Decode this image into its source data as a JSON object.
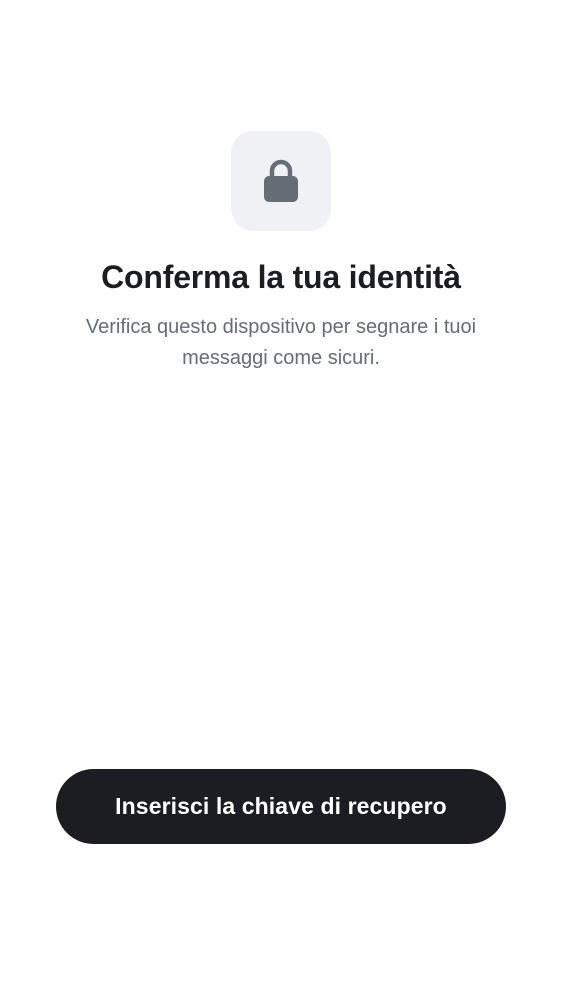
{
  "screen": {
    "icon": "lock-icon",
    "title": "Conferma la tua identità",
    "subtitle": "Verifica questo dispositivo per segnare i tuoi messaggi come sicuri."
  },
  "actions": {
    "primary_label": "Inserisci la chiave di recupero"
  },
  "colors": {
    "background": "#ffffff",
    "icon_tile": "#f0f1f4",
    "icon": "#656d77",
    "title": "#1b1d22",
    "subtitle": "#656d77",
    "button_bg": "#1b1d22",
    "button_text": "#ffffff"
  }
}
